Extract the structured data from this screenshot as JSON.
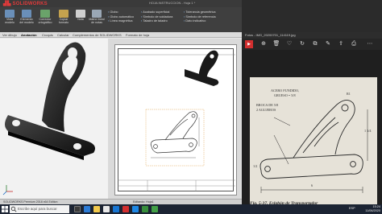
{
  "solidworks": {
    "logo": "SOLIDWORKS",
    "title": "HOJA INSTRUCCION - Hoja 1 *",
    "search_placeholder": "Buscar en el Foro",
    "ribbon_buttons": [
      {
        "label": "Vista modelo",
        "icon": "model-view-icon"
      },
      {
        "label": "Elemento del modelo",
        "icon": "model-items-icon"
      },
      {
        "label": "Corrector ortográfico",
        "icon": "spell-check-icon"
      },
      {
        "label": "Copiar formato",
        "icon": "format-painter-icon"
      },
      {
        "label": "Nota",
        "icon": "note-icon"
      },
      {
        "label": "Matriz lineal de notas",
        "icon": "linear-note-pattern-icon"
      }
    ],
    "ribbon_group_1": [
      "Globo",
      "Globo automático",
      "Línea magnética"
    ],
    "ribbon_group_2": [
      "Acabado superficial",
      "Símbolo de soldadura",
      "Taladro de taladro"
    ],
    "ribbon_group_3": [
      "Tolerancia geométrica",
      "Símbolo de referencia",
      "Símbolo de evaluación de referencia",
      "Dato indicativo"
    ],
    "ribbon_button_bloques": "Bloques",
    "ribbon_group_4": [
      "Centro de círculo",
      "Línea constructiva",
      "Área rayada/Rellenar"
    ],
    "ribbon_group_5": [
      "Símbolo de revisión",
      "Nube de revisión"
    ],
    "tabs": [
      "Ver dibujo",
      "Anotación",
      "Croquis",
      "Calcular",
      "Complementos de SOLIDWORKS",
      "Formato de hoja"
    ],
    "active_tab": "Anotación",
    "status": "SOLIDWORKS Premium 2018 x64 Edition",
    "sheet_tabs": [
      "Editando: Hoja1",
      "Hoja1"
    ]
  },
  "photos": {
    "title": "Fotos - IMG_20200701_114119.jpg",
    "toolbar": [
      {
        "icon": "slideshow-icon",
        "label": "▶"
      },
      {
        "icon": "zoom-in-icon",
        "label": "⊕"
      },
      {
        "icon": "delete-icon",
        "label": "🗑"
      },
      {
        "icon": "favorite-icon",
        "label": "♡"
      },
      {
        "icon": "rotate-icon",
        "label": "↻"
      },
      {
        "icon": "crop-icon",
        "label": "⧉"
      },
      {
        "icon": "edit-icon",
        "label": "✎"
      },
      {
        "icon": "share-icon",
        "label": "⇪"
      },
      {
        "icon": "print-icon",
        "label": "⎙"
      },
      {
        "icon": "more-icon",
        "label": "⋯"
      }
    ],
    "annotations": {
      "material": "ACERO FUNDIDO,",
      "thickness": "GRUESO = 5/8",
      "drill": "BROCA DE 5/8",
      "holes": "2 AGUJEROS",
      "dim_center": "6",
      "dim_radius": "R1",
      "dim_top": "1 3/4",
      "dim_left": "1/2"
    },
    "caption": "Fig. 5-37.  Eslabón de Transportador"
  },
  "taskbar": {
    "search_placeholder": "Escribe aquí para buscar",
    "language": "ESP",
    "time": "15:24",
    "date": "11/06/2020"
  },
  "colors": {
    "sw_accent": "#e03a3a",
    "photos_accent": "#d32f2f",
    "ribbon_bg": "#3f3f3f",
    "taskbar_bg": "#1c2433"
  }
}
